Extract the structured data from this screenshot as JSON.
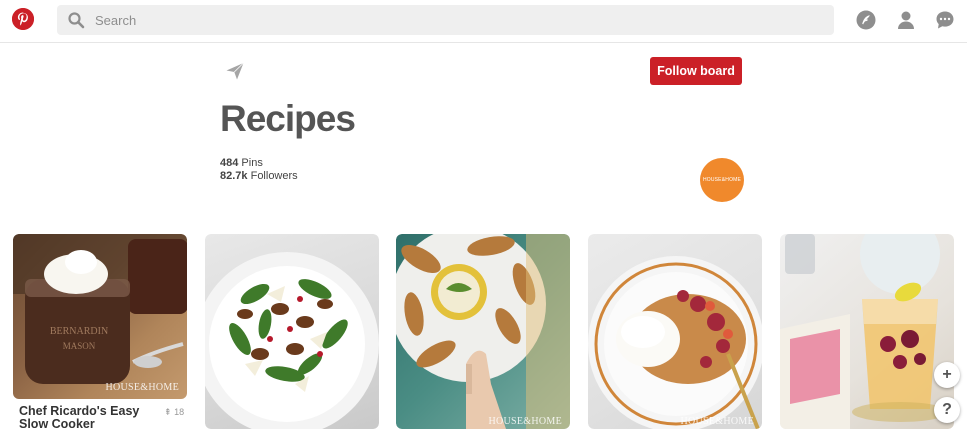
{
  "search": {
    "placeholder": "Search"
  },
  "board": {
    "title": "Recipes",
    "pins_count": "484",
    "pins_label": "Pins",
    "followers_count": "82.7k",
    "followers_label": "Followers",
    "follow_button": "Follow board",
    "owner_avatar_text": "HOUSE&HOME"
  },
  "pins": [
    {
      "title": "Chef Ricardo's Easy Slow Cooker",
      "save_count": "18",
      "watermark": "HOUSE&HOME"
    },
    {
      "title": "",
      "save_count": "",
      "watermark": ""
    },
    {
      "title": "",
      "save_count": "",
      "watermark": "HOUSE&HOME"
    },
    {
      "title": "",
      "save_count": "",
      "watermark": "HOUSE&HOME"
    },
    {
      "title": "",
      "save_count": "",
      "watermark": ""
    }
  ],
  "floating": {
    "add_label": "+",
    "help_label": "?"
  },
  "colors": {
    "brand": "#cb2027",
    "avatar": "#f0892c"
  }
}
